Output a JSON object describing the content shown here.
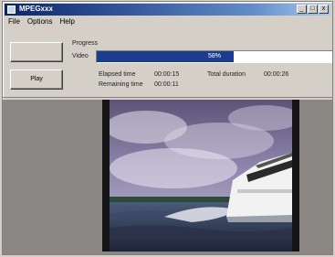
{
  "window": {
    "title": "MPEGxxx",
    "min_label": "_",
    "max_label": "□",
    "close_label": "x"
  },
  "menu": {
    "items": [
      "File",
      "Options",
      "Help"
    ]
  },
  "buttons": {
    "top_label": "",
    "play_label": "Play"
  },
  "progress": {
    "heading": "Progress",
    "row_label": "Video",
    "value_fraction": 0.58,
    "text": "58%"
  },
  "times": {
    "elapsed_label": "Elapsed time",
    "elapsed_value": "00:00:15",
    "remaining_label": "Remaining time",
    "remaining_value": "00:00:11",
    "total_label": "Total duration",
    "total_value": "00:00:26"
  },
  "colors": {
    "accent": "#1c3c8c",
    "face": "#d4d0c8",
    "video_bg": "#8a8784"
  }
}
